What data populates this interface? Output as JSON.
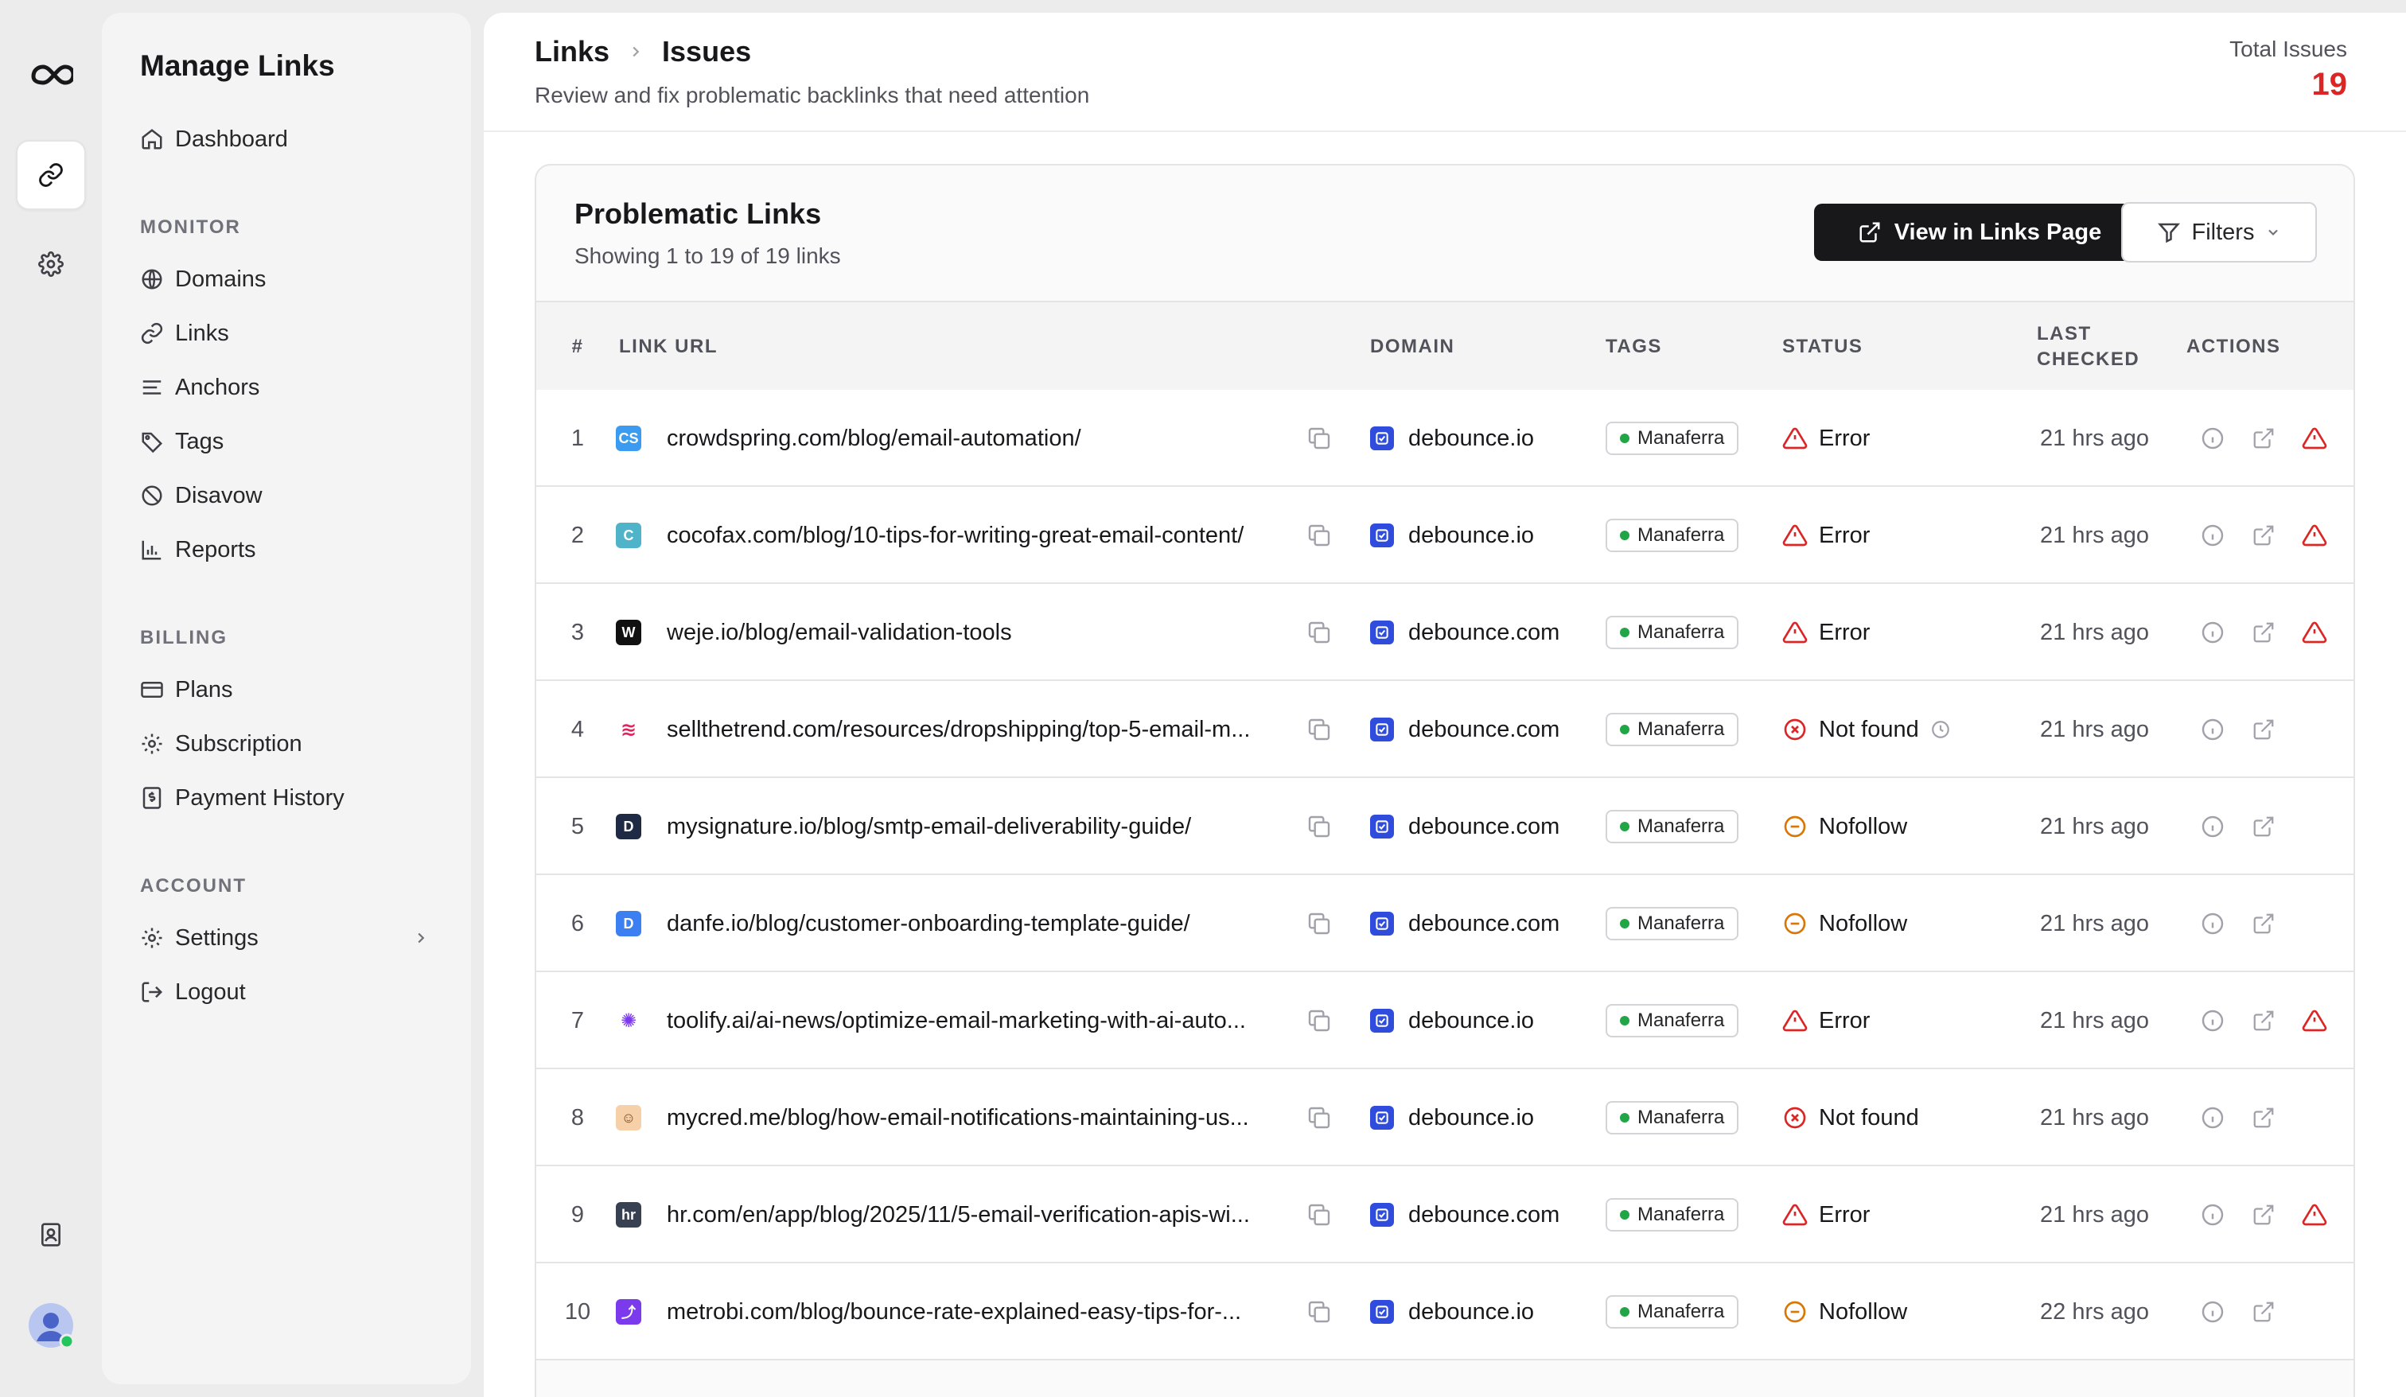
{
  "sidebar": {
    "title": "Manage Links",
    "dashboard": "Dashboard",
    "sections": {
      "monitor": "MONITOR",
      "billing": "BILLING",
      "account": "ACCOUNT"
    },
    "monitor_items": [
      "Domains",
      "Links",
      "Anchors",
      "Tags",
      "Disavow",
      "Reports"
    ],
    "billing_items": [
      "Plans",
      "Subscription",
      "Payment History"
    ],
    "account_items": [
      "Settings",
      "Logout"
    ]
  },
  "header": {
    "breadcrumb": [
      "Links",
      "Issues"
    ],
    "subtitle": "Review and fix problematic backlinks that need attention",
    "total_label": "Total Issues",
    "total_value": "19"
  },
  "card": {
    "title": "Problematic Links",
    "subtitle": "Showing 1 to 19 of 19 links",
    "view_button": "View in Links Page",
    "filters_button": "Filters"
  },
  "table": {
    "columns": [
      "#",
      "LINK URL",
      "DOMAIN",
      "TAGS",
      "STATUS",
      "LAST CHECKED",
      "ACTIONS"
    ],
    "rows": [
      {
        "n": "1",
        "url": "crowdspring.com/blog/email-automation/",
        "domain": "debounce.io",
        "tag": "Manaferra",
        "status": "Error",
        "checked": "21 hrs ago"
      },
      {
        "n": "2",
        "url": "cocofax.com/blog/10-tips-for-writing-great-email-content/",
        "domain": "debounce.io",
        "tag": "Manaferra",
        "status": "Error",
        "checked": "21 hrs ago"
      },
      {
        "n": "3",
        "url": "weje.io/blog/email-validation-tools",
        "domain": "debounce.com",
        "tag": "Manaferra",
        "status": "Error",
        "checked": "21 hrs ago"
      },
      {
        "n": "4",
        "url": "sellthetrend.com/resources/dropshipping/top-5-email-m...",
        "domain": "debounce.com",
        "tag": "Manaferra",
        "status": "Not found",
        "checked": "21 hrs ago"
      },
      {
        "n": "5",
        "url": "mysignature.io/blog/smtp-email-deliverability-guide/",
        "domain": "debounce.com",
        "tag": "Manaferra",
        "status": "Nofollow",
        "checked": "21 hrs ago"
      },
      {
        "n": "6",
        "url": "danfe.io/blog/customer-onboarding-template-guide/",
        "domain": "debounce.com",
        "tag": "Manaferra",
        "status": "Nofollow",
        "checked": "21 hrs ago"
      },
      {
        "n": "7",
        "url": "toolify.ai/ai-news/optimize-email-marketing-with-ai-auto...",
        "domain": "debounce.io",
        "tag": "Manaferra",
        "status": "Error",
        "checked": "21 hrs ago"
      },
      {
        "n": "8",
        "url": "mycred.me/blog/how-email-notifications-maintaining-us...",
        "domain": "debounce.io",
        "tag": "Manaferra",
        "status": "Not found",
        "checked": "21 hrs ago"
      },
      {
        "n": "9",
        "url": "hr.com/en/app/blog/2025/11/5-email-verification-apis-wi...",
        "domain": "debounce.com",
        "tag": "Manaferra",
        "status": "Error",
        "checked": "21 hrs ago"
      },
      {
        "n": "10",
        "url": "metrobi.com/blog/bounce-rate-explained-easy-tips-for-...",
        "domain": "debounce.io",
        "tag": "Manaferra",
        "status": "Nofollow",
        "checked": "22 hrs ago"
      }
    ]
  },
  "colors": {
    "error": "#dc2626",
    "nofollow": "#d97706",
    "tag_dot": "#22a547",
    "domain_icon": "#2f4cdc"
  }
}
